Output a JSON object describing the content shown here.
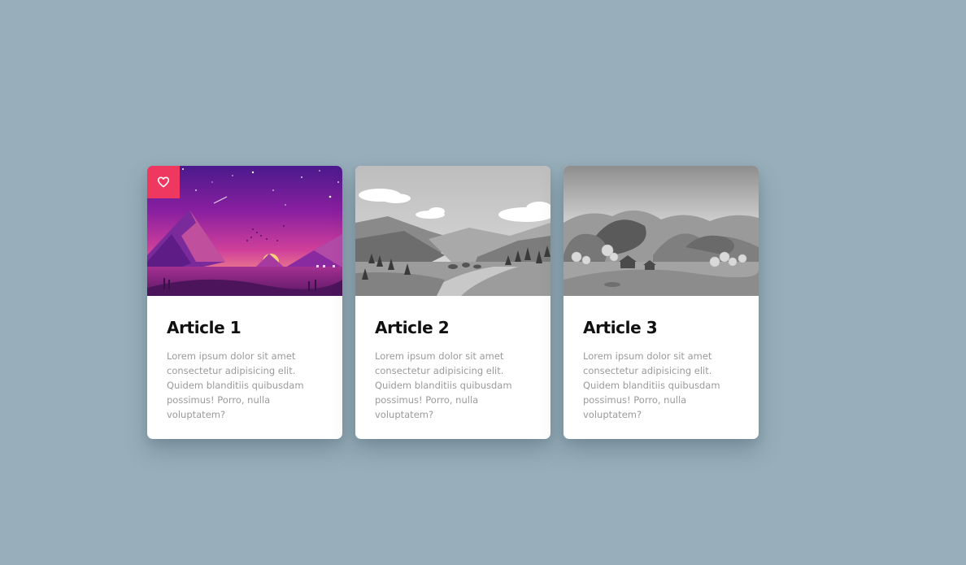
{
  "cards": [
    {
      "title": "Article 1",
      "text": "Lorem ipsum dolor sit amet consectetur adipisicing elit. Quidem blanditiis quibusdam possimus! Porro, nulla voluptatem?",
      "favorited": true,
      "image": "purple-mountain-sunset-illustration"
    },
    {
      "title": "Article 2",
      "text": "Lorem ipsum dolor sit amet consectetur adipisicing elit. Quidem blanditiis quibusdam possimus! Porro, nulla voluptatem?",
      "favorited": false,
      "image": "grayscale-mountain-valley-illustration"
    },
    {
      "title": "Article 3",
      "text": "Lorem ipsum dolor sit amet consectetur adipisicing elit. Quidem blanditiis quibusdam possimus! Porro, nulla voluptatem?",
      "favorited": false,
      "image": "grayscale-hills-village-illustration"
    }
  ],
  "favorite_icon": "heart-icon",
  "colors": {
    "background": "#98afbb",
    "favorite": "#ee3860",
    "title": "#111111",
    "text": "#9a9a9a"
  }
}
